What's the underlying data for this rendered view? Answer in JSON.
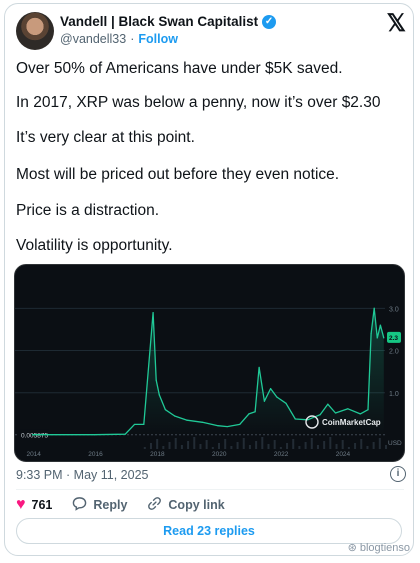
{
  "tweet": {
    "author_name": "Vandell | Black Swan Capitalist",
    "handle": "@vandell33",
    "separator": "·",
    "follow_label": "Follow",
    "paragraphs": [
      "Over 50% of Americans have under $5K saved.",
      "In 2017, XRP was below a penny, now it’s over $2.30",
      "It’s very clear at this point.",
      "Most will be priced out before they even notice.",
      "Price is a distraction.",
      "Volatility is opportunity."
    ],
    "timestamp": "9:33 PM · May 11, 2025",
    "likes_count": "761",
    "reply_label": "Reply",
    "copy_link_label": "Copy link",
    "read_replies_label": "Read 23 replies"
  },
  "icons": {
    "verified": "verified-badge-icon",
    "x_logo": "x-logo-icon",
    "info": "info-icon",
    "like": "heart-icon",
    "reply": "reply-icon",
    "copy_link": "link-icon"
  },
  "colors": {
    "accent": "#1d9bf0",
    "like": "#f91880",
    "chart_line": "#20c997",
    "chart_bg": "#0b0f14"
  },
  "chart_data": {
    "type": "line",
    "x_ticks": [
      "2014",
      "2016",
      "2018",
      "2020",
      "2022",
      "2024"
    ],
    "y_ticks": [
      "1.0",
      "2.0",
      "3.0"
    ],
    "baseline_label": "0.005875",
    "current_label": "2.3",
    "currency_label": "USD",
    "watermark": "CoinMarketCap",
    "xlim": [
      2013.5,
      2025.4
    ],
    "ylim": [
      0,
      3.6
    ],
    "x": [
      2014.0,
      2016.0,
      2017.0,
      2017.3,
      2017.6,
      2017.9,
      2018.0,
      2018.1,
      2018.3,
      2018.6,
      2019.0,
      2019.5,
      2020.0,
      2020.3,
      2020.7,
      2021.0,
      2021.2,
      2021.33,
      2021.5,
      2021.7,
      2021.9,
      2022.2,
      2022.5,
      2022.9,
      2023.3,
      2023.55,
      2023.8,
      2024.2,
      2024.6,
      2024.85,
      2024.95,
      2025.05,
      2025.15,
      2025.25,
      2025.36
    ],
    "y": [
      0.006,
      0.006,
      0.02,
      0.25,
      0.25,
      2.9,
      1.3,
      0.95,
      0.6,
      0.45,
      0.35,
      0.3,
      0.22,
      0.2,
      0.25,
      0.5,
      0.55,
      1.6,
      0.8,
      1.1,
      0.9,
      0.75,
      0.38,
      0.36,
      0.48,
      0.73,
      0.52,
      0.62,
      0.5,
      0.6,
      2.4,
      3.0,
      2.3,
      2.6,
      2.3
    ]
  },
  "watermark": {
    "text": "blogtienso",
    "icon": "wechat-icon"
  }
}
